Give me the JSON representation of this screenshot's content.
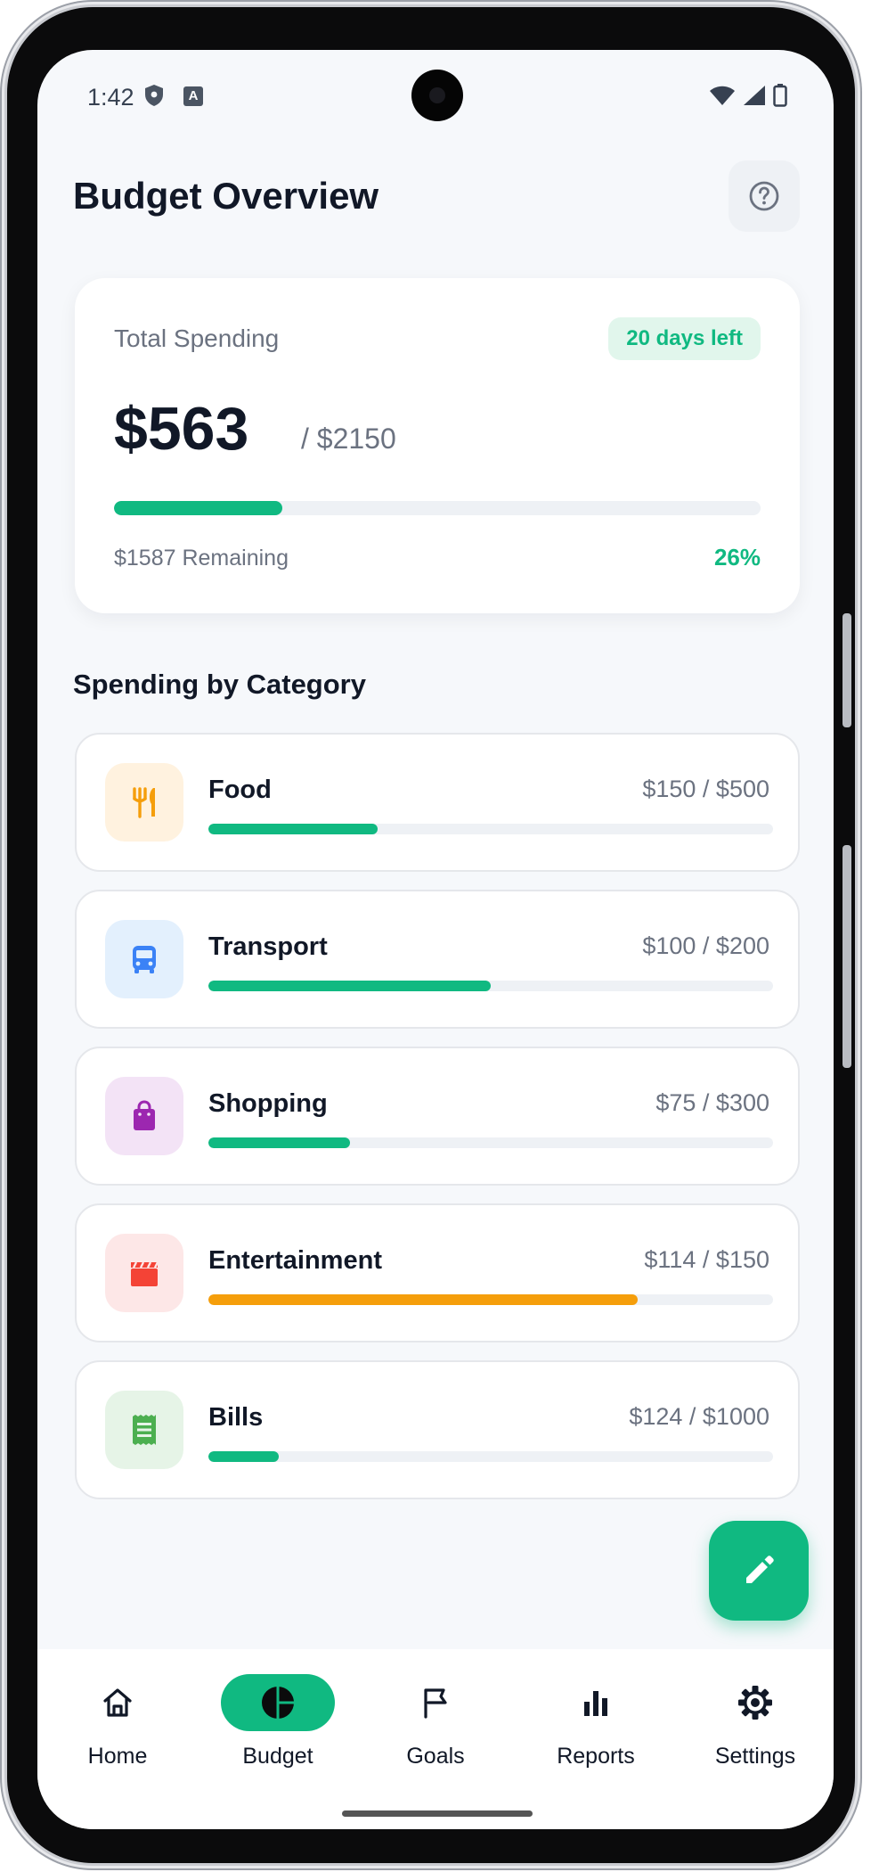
{
  "status_bar": {
    "time": "1:42",
    "a_label": "A"
  },
  "header": {
    "title": "Budget Overview"
  },
  "summary": {
    "label": "Total Spending",
    "days_left": "20 days left",
    "amount": "$563",
    "total": "/ $2150",
    "progress": 0.26,
    "remaining": "$1587 Remaining",
    "percent": "26%",
    "accent": "#10b981"
  },
  "section": {
    "title": "Spending by Category"
  },
  "categories": [
    {
      "name": "Food",
      "amount": "$150 / $500",
      "progress": 0.3,
      "icon": "fork-knife-icon",
      "icon_color": "#f59e0b",
      "icon_bg": "#fff2df",
      "bar_color": "#10b981"
    },
    {
      "name": "Transport",
      "amount": "$100 / $200",
      "progress": 0.5,
      "icon": "bus-icon",
      "icon_color": "#3b82f6",
      "icon_bg": "#e3f0fd",
      "bar_color": "#10b981"
    },
    {
      "name": "Shopping",
      "amount": "$75 / $300",
      "progress": 0.25,
      "icon": "shopping-bag-icon",
      "icon_color": "#9c27b0",
      "icon_bg": "#f3e3f6",
      "bar_color": "#10b981"
    },
    {
      "name": "Entertainment",
      "amount": "$114 / $150",
      "progress": 0.76,
      "icon": "clapperboard-icon",
      "icon_color": "#f44336",
      "icon_bg": "#fde7e7",
      "bar_color": "#f59e0b"
    },
    {
      "name": "Bills",
      "amount": "$124 / $1000",
      "progress": 0.124,
      "icon": "receipt-icon",
      "icon_color": "#4caf50",
      "icon_bg": "#e6f4e7",
      "bar_color": "#10b981"
    }
  ],
  "nav": [
    {
      "label": "Home",
      "icon": "home-icon",
      "active": false
    },
    {
      "label": "Budget",
      "icon": "pie-chart-icon",
      "active": true
    },
    {
      "label": "Goals",
      "icon": "flag-icon",
      "active": false
    },
    {
      "label": "Reports",
      "icon": "bar-chart-icon",
      "active": false
    },
    {
      "label": "Settings",
      "icon": "gear-icon",
      "active": false
    }
  ]
}
